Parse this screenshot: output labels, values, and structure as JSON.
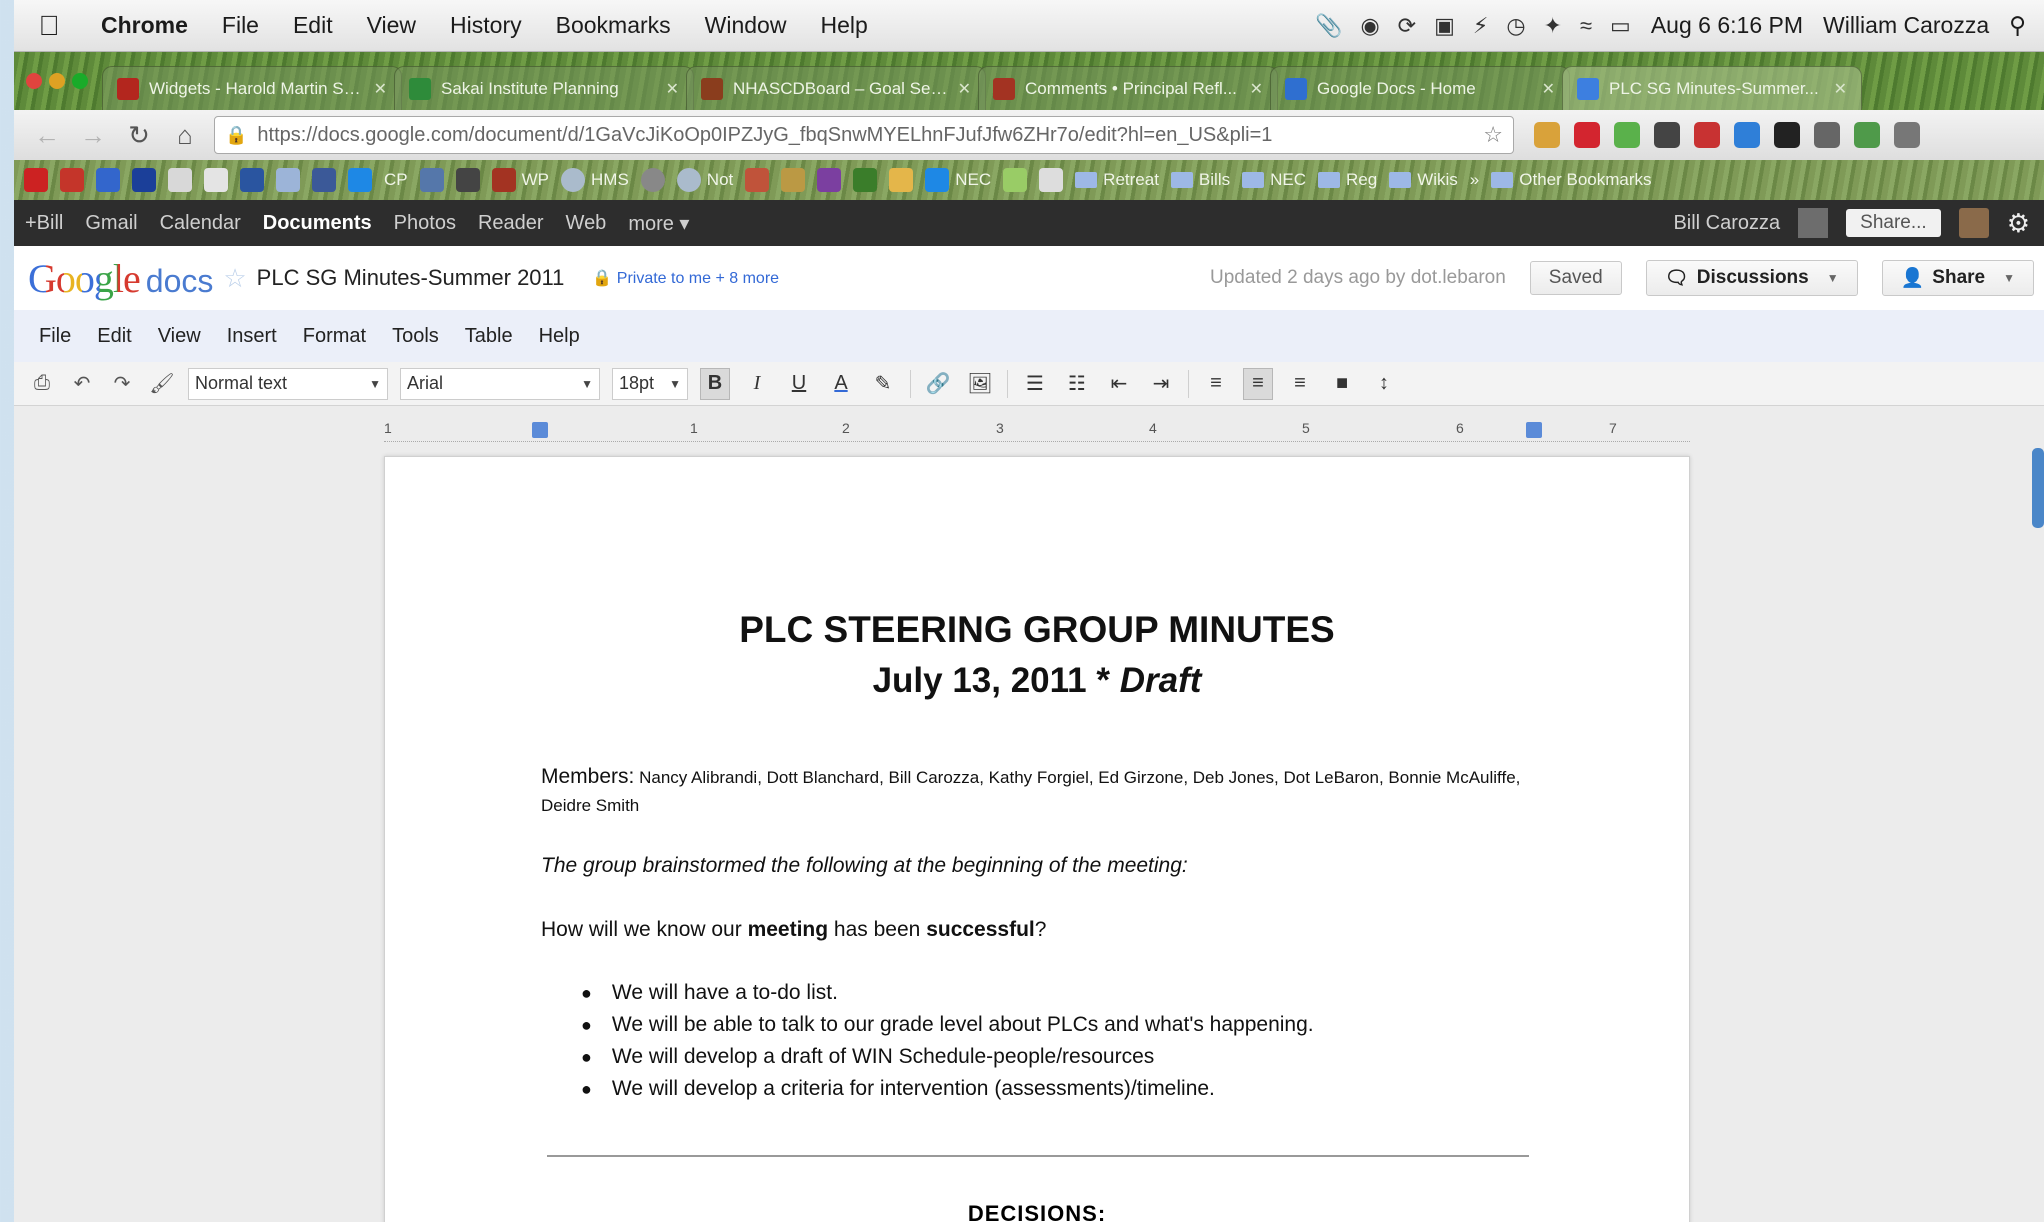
{
  "menubar": {
    "apple": "",
    "items": [
      "Chrome",
      "File",
      "Edit",
      "View",
      "History",
      "Bookmarks",
      "Window",
      "Help"
    ],
    "datetime": "Aug 6  6:16 PM",
    "user": "William Carozza"
  },
  "tabs": [
    {
      "title": "Widgets - Harold Martin Sc...",
      "color": "#b3261e"
    },
    {
      "title": "Sakai Institute Planning",
      "color": "#2e8b3a"
    },
    {
      "title": "NHASCDBoard – Goal Sett...",
      "color": "#8a3d1d"
    },
    {
      "title": "Comments • Principal Refl...",
      "color": "#a33322"
    },
    {
      "title": "Google Docs - Home",
      "color": "#2f6fd0"
    },
    {
      "title": "PLC SG Minutes-Summer...",
      "color": "#3d7fe0"
    }
  ],
  "address": {
    "url": "https://docs.google.com/document/d/1GaVcJiKoOp0IPZJyG_fbqSnwMYELhnFJufJfw6ZHr7o/edit?hl=en_US&pli=1"
  },
  "bookmarks": {
    "items": [
      "CP",
      "WP",
      "HMS",
      "Not",
      "NEC"
    ],
    "folders": [
      "Retreat",
      "Bills",
      "NEC",
      "Reg",
      "Wikis"
    ],
    "other": "Other Bookmarks"
  },
  "gbar": {
    "links": [
      "+Bill",
      "Gmail",
      "Calendar",
      "Documents",
      "Photos",
      "Reader",
      "Web",
      "more ▾"
    ],
    "active": "Documents",
    "user": "Bill Carozza",
    "share": "Share..."
  },
  "docheader": {
    "logo_google": "Google",
    "logo_docs": "docs",
    "title": "PLC SG Minutes-Summer 2011",
    "privacy": "Private to me + 8 more",
    "updated": "Updated 2 days ago by dot.lebaron",
    "saved": "Saved",
    "discussions": "Discussions",
    "share": "Share"
  },
  "docmenu": [
    "File",
    "Edit",
    "View",
    "Insert",
    "Format",
    "Tools",
    "Table",
    "Help"
  ],
  "toolbar": {
    "style": "Normal text",
    "font": "Arial",
    "size": "18pt",
    "bold": "B",
    "italic": "I",
    "underline": "U",
    "text_color": "A"
  },
  "ruler": [
    "1",
    "1",
    "2",
    "3",
    "4",
    "5",
    "6",
    "7"
  ],
  "document": {
    "title1": "PLC STEERING GROUP MINUTES",
    "title2_date": "July 13, 2011 * ",
    "title2_draft": "Draft",
    "members_label": "Members:",
    "members": " Nancy Alibrandi, Dott Blanchard, Bill Carozza, Kathy Forgiel, Ed Girzone, Deb Jones, Dot LeBaron, Bonnie McAuliffe, Deidre Smith",
    "intro": "The group brainstormed the following at the beginning of the meeting:",
    "question_a": "How will we know our ",
    "question_b": "meeting",
    "question_c": " has been ",
    "question_d": "successful",
    "question_e": "?",
    "bullets": [
      "We will have a to-do list.",
      "We will be able to talk to our grade level about PLCs and what's happening.",
      "We will develop a draft of WIN Schedule-people/resources",
      "We will develop a criteria for intervention (assessments)/timeline."
    ],
    "decisions": "DECISIONS:"
  },
  "colors": {
    "accent_blue": "#3369d6",
    "gbar": "#2d2d2d",
    "menu_bg": "#ebeff9"
  }
}
